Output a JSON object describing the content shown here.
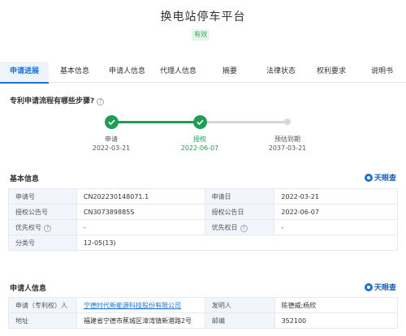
{
  "header": {
    "title": "换电站停车平台",
    "status": "有效"
  },
  "tabs": [
    "申请进展",
    "基本信息",
    "申请人信息",
    "代理人信息",
    "摘要",
    "法律状态",
    "权利要求",
    "说明书"
  ],
  "faq": {
    "question": "专利申请流程有哪些步骤?",
    "help_icon": "?"
  },
  "progress": {
    "steps": [
      {
        "label": "申请",
        "date": "2022-03-21",
        "state": "done"
      },
      {
        "label": "授权",
        "date": "2022-06-07",
        "state": "current"
      },
      {
        "label": "预估到期",
        "date": "2037-03-21",
        "state": "pending"
      }
    ],
    "done_color": "#1f9d55",
    "pending_color": "#d8d8d8"
  },
  "basic_info": {
    "title": "基本信息",
    "logo": "天眼查",
    "rows": [
      {
        "k1": "申请号",
        "v1": "CN202230148071.1",
        "k2": "申请日",
        "v2": "2022-03-21"
      },
      {
        "k1": "授权公告号",
        "v1": "CN307389885S",
        "k2": "授权公告日",
        "v2": "2022-06-07"
      },
      {
        "k1": "优先权号",
        "v1": "-",
        "k2": "优先权日",
        "v2": "-"
      },
      {
        "k1": "分类号",
        "v1": "12-05(13)"
      }
    ]
  },
  "applicant_info": {
    "title": "申请人信息",
    "logo": "天眼查",
    "rows": [
      {
        "k1": "申请（专利权）人",
        "v1": "宁德时代新能源科技股份有限公司",
        "k2": "发明人",
        "v2": "陈德威;杨欣"
      },
      {
        "k1": "地址",
        "v1": "福建省宁德市蕉城区漳湾镇新港路2号",
        "k2": "邮编",
        "v2": "352100"
      }
    ]
  },
  "colors": {
    "accent": "#1a73d6",
    "success": "#1f9d55",
    "key_bg": "#f2f6fc"
  }
}
